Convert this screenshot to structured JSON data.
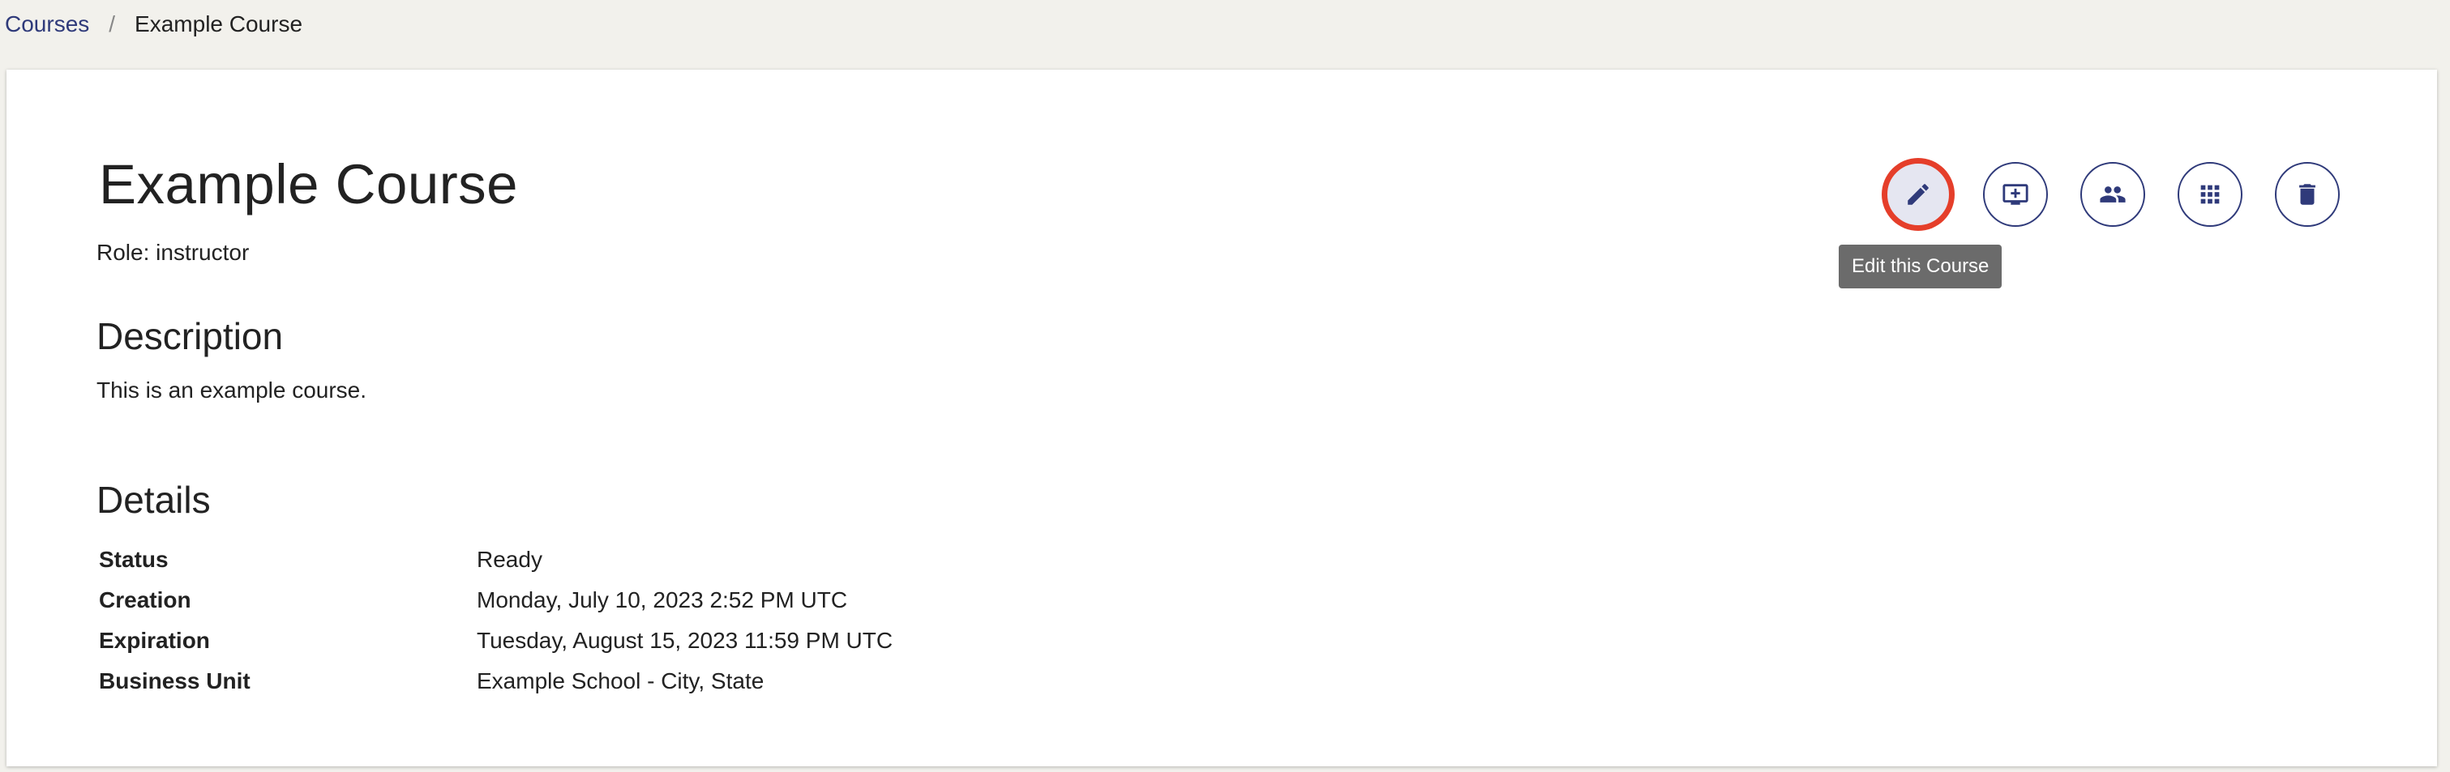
{
  "breadcrumb": {
    "root": "Courses",
    "separator": "/",
    "current": "Example Course"
  },
  "course": {
    "title": "Example Course",
    "role_line": "Role: instructor"
  },
  "description": {
    "heading": "Description",
    "text": "This is an example course."
  },
  "details": {
    "heading": "Details",
    "rows": [
      {
        "key": "Status",
        "value": "Ready"
      },
      {
        "key": "Creation",
        "value": "Monday, July 10, 2023 2:52 PM UTC"
      },
      {
        "key": "Expiration",
        "value": "Tuesday, August 15, 2023 11:59 PM UTC"
      },
      {
        "key": "Business Unit",
        "value": "Example School - City, State"
      }
    ]
  },
  "actions": {
    "tooltip": "Edit this Course",
    "buttons": [
      {
        "icon": "pencil-icon",
        "active": true
      },
      {
        "icon": "add-to-screen-icon",
        "active": false
      },
      {
        "icon": "people-icon",
        "active": false
      },
      {
        "icon": "grid-icon",
        "active": false
      },
      {
        "icon": "trash-icon",
        "active": false
      }
    ]
  },
  "colors": {
    "accent": "#2f3a7a",
    "highlight_ring": "#e53e2a",
    "page_background": "#f2f1ec",
    "tooltip_background": "#6b6b6b"
  }
}
